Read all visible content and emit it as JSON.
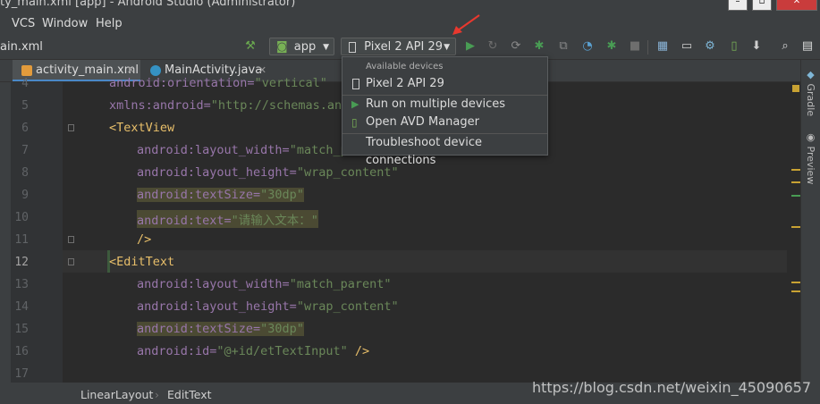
{
  "window": {
    "title": "ty_main.xml [app] - Android Studio (Administrator)"
  },
  "menu": {
    "items": [
      "VCS",
      "Window",
      "Help"
    ]
  },
  "toolbar": {
    "project_crumb": "ain.xml",
    "config_label": "app",
    "device_label": "Pixel 2 API 29"
  },
  "tabs": [
    {
      "label": "activity_main.xml",
      "icon": "xml-file-icon"
    },
    {
      "label": "MainActivity.java",
      "icon": "java-class-icon"
    }
  ],
  "editor": {
    "line_numbers": [
      "4",
      "5",
      "6",
      "7",
      "8",
      "9",
      "10",
      "11",
      "12",
      "13",
      "14",
      "15",
      "16",
      "17"
    ],
    "current_line": "12",
    "lines": [
      {
        "attr": "android:orientation=",
        "val": "\"vertical\""
      },
      {
        "attr": "xmlns:android=",
        "val": "\"http://schemas.and"
      },
      {
        "tag": "<TextView"
      },
      {
        "attr": "android:layout_width=",
        "val": "\"match_pare"
      },
      {
        "attr": "android:layout_height=",
        "val": "\"wrap_content\""
      },
      {
        "attr": "android:textSize=",
        "val": "\"30dp\""
      },
      {
        "attr": "android:text=",
        "val": "\"请输入文本：\""
      },
      {
        "tag": "/>"
      },
      {
        "tag": "<EditText"
      },
      {
        "attr": "android:layout_width=",
        "val": "\"match_parent\""
      },
      {
        "attr": "android:layout_height=",
        "val": "\"wrap_content\""
      },
      {
        "attr": "android:textSize=",
        "val": "\"30dp\""
      },
      {
        "attr": "android:id=",
        "val": "\"@+id/etTextInput\"",
        "tail": " />"
      }
    ]
  },
  "popup": {
    "header": "Available devices",
    "device": "Pixel 2 API 29",
    "run_multiple": "Run on multiple devices",
    "avd_manager": "Open AVD Manager",
    "troubleshoot": "Troubleshoot device connections"
  },
  "side_panels": {
    "gradle": "Gradle",
    "preview": "Preview"
  },
  "breadcrumbs": [
    "LinearLayout",
    "EditText"
  ],
  "watermark": "https://blog.csdn.net/weixin_45090657",
  "colors": {
    "accent_arrow": "#e8382e",
    "run_green": "#499c54",
    "attr_purple": "#9876aa",
    "value_green": "#6a8759",
    "tag_yellow": "#e8bf6a"
  }
}
